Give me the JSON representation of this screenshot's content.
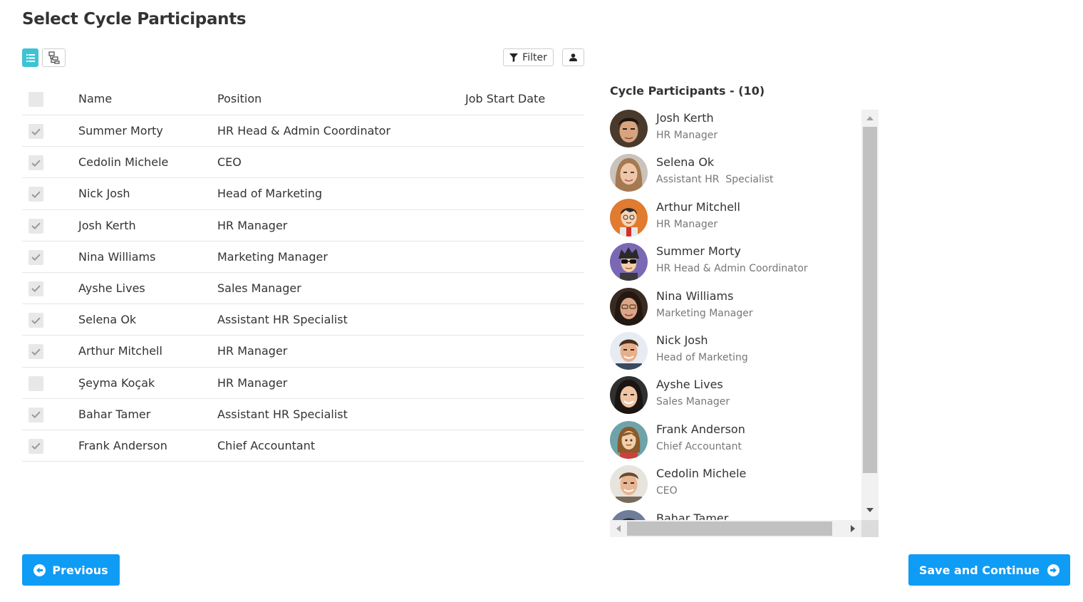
{
  "page": {
    "title": "Select Cycle Participants"
  },
  "toolbar": {
    "list_view_icon": "list-icon",
    "tree_view_icon": "hierarchy-icon",
    "filter_label": "Filter",
    "filter_icon": "funnel-icon",
    "user_icon": "user-icon"
  },
  "table": {
    "headers": {
      "name": "Name",
      "position": "Position",
      "job_start_date": "Job Start Date"
    },
    "rows": [
      {
        "name": "Summer Morty",
        "position": "HR Head & Admin Coordinator",
        "job_start_date": "",
        "checked": true
      },
      {
        "name": "Cedolin Michele",
        "position": "CEO",
        "job_start_date": "",
        "checked": true
      },
      {
        "name": "Nick Josh",
        "position": "Head of Marketing",
        "job_start_date": "",
        "checked": true
      },
      {
        "name": "Josh Kerth",
        "position": "HR Manager",
        "job_start_date": "",
        "checked": true
      },
      {
        "name": "Nina Williams",
        "position": "Marketing Manager",
        "job_start_date": "",
        "checked": true
      },
      {
        "name": "Ayshe Lives",
        "position": "Sales Manager",
        "job_start_date": "",
        "checked": true
      },
      {
        "name": "Selena Ok",
        "position": "Assistant HR Specialist",
        "job_start_date": "",
        "checked": true
      },
      {
        "name": "Arthur Mitchell",
        "position": "HR Manager",
        "job_start_date": "",
        "checked": true
      },
      {
        "name": "Şeyma Koçak",
        "position": "HR Manager",
        "job_start_date": "",
        "checked": false
      },
      {
        "name": "Bahar Tamer",
        "position": "Assistant HR Specialist",
        "job_start_date": "",
        "checked": true
      },
      {
        "name": "Frank Anderson",
        "position": "Chief Accountant",
        "job_start_date": "",
        "checked": true
      }
    ]
  },
  "participants": {
    "title": "Cycle Participants - (10)",
    "items": [
      {
        "name": "Josh Kerth",
        "position": "HR Manager"
      },
      {
        "name": "Selena Ok",
        "position": "Assistant HR  Specialist"
      },
      {
        "name": "Arthur Mitchell",
        "position": "HR Manager"
      },
      {
        "name": "Summer Morty",
        "position": "HR Head & Admin Coordinator"
      },
      {
        "name": "Nina Williams",
        "position": "Marketing Manager"
      },
      {
        "name": "Nick Josh",
        "position": "Head of Marketing"
      },
      {
        "name": "Ayshe Lives",
        "position": "Sales Manager"
      },
      {
        "name": "Frank Anderson",
        "position": "Chief Accountant"
      },
      {
        "name": "Cedolin Michele",
        "position": "CEO"
      },
      {
        "name": "Bahar Tamer",
        "position": ""
      }
    ]
  },
  "footer": {
    "previous_label": "Previous",
    "save_label": "Save and Continue"
  },
  "colors": {
    "accent": "#0f9cf5",
    "list_view_active": "#3ec3d5"
  }
}
